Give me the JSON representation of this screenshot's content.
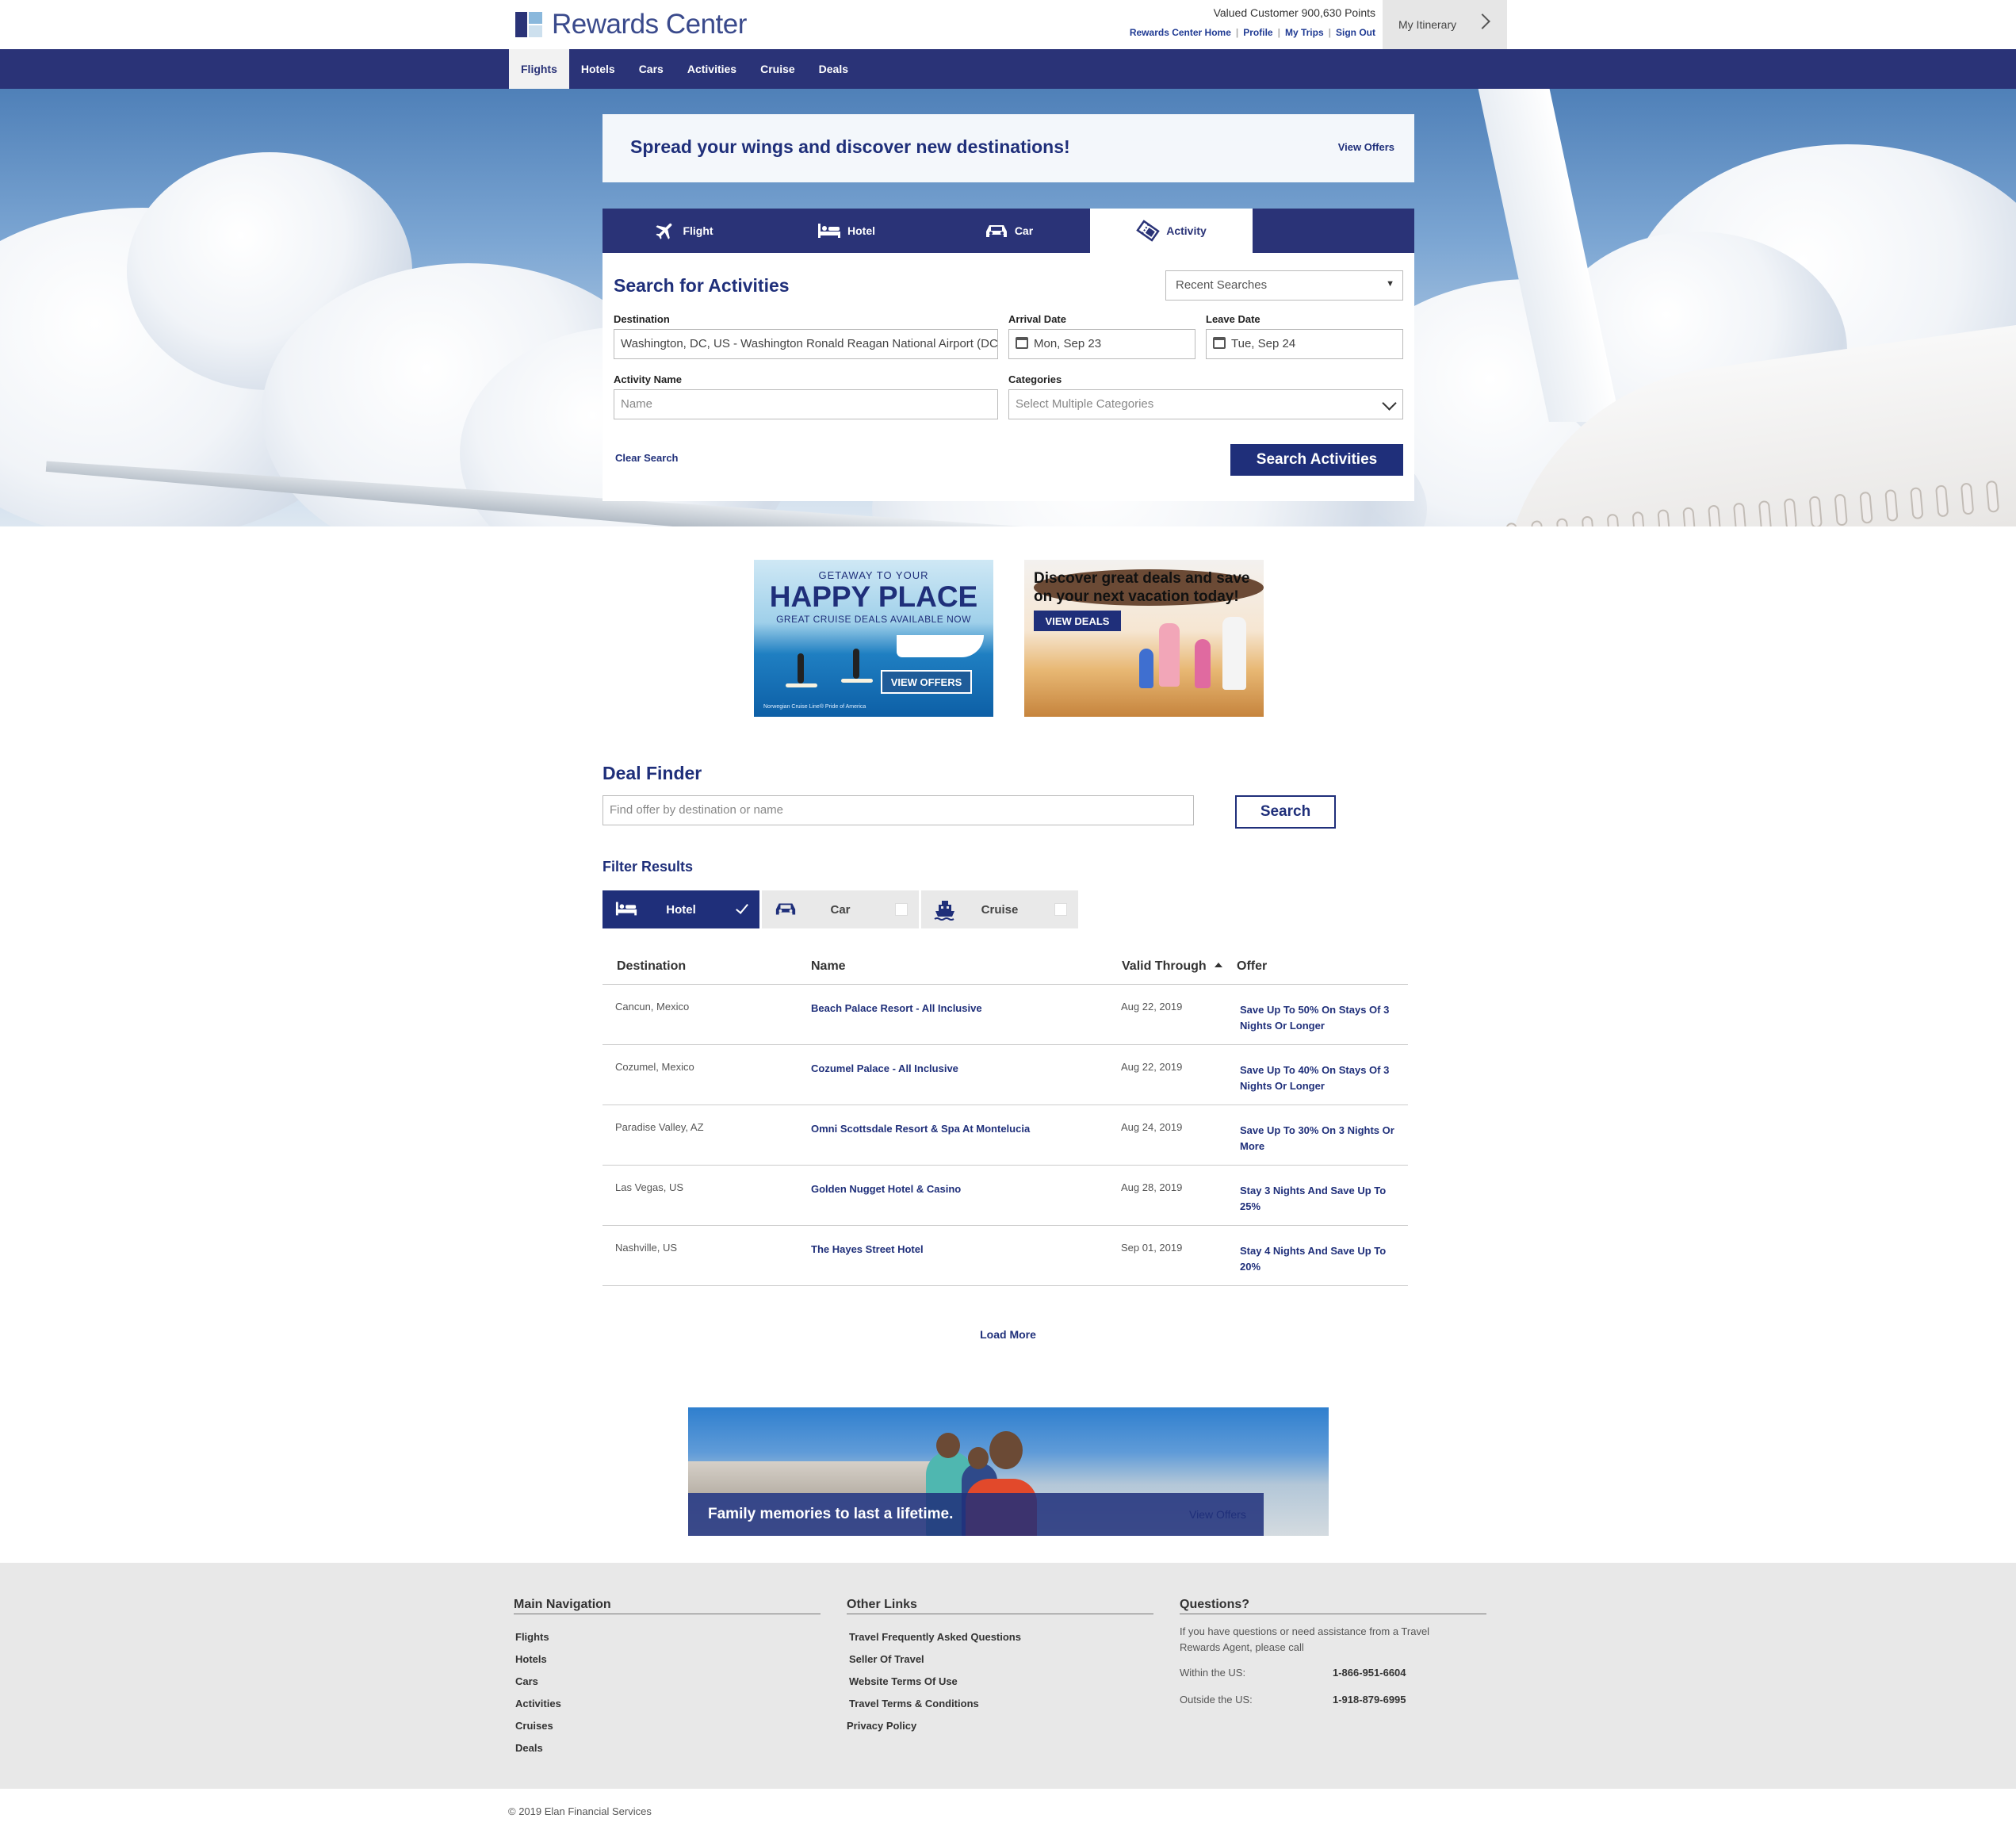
{
  "brand": {
    "name": "Rewards Center",
    "colors": {
      "primary": "#2a3377",
      "link": "#1f2f7a",
      "footer_bg": "#e8e8e8"
    }
  },
  "header": {
    "customer": "Valued Customer 900,630 Points",
    "links": [
      "Rewards Center Home",
      "Profile",
      "My Trips",
      "Sign Out"
    ],
    "itinerary": "My Itinerary"
  },
  "nav": {
    "items": [
      "Flights",
      "Hotels",
      "Cars",
      "Activities",
      "Cruise",
      "Deals"
    ],
    "active": "Flights"
  },
  "promo": {
    "title": "Spread your wings and discover new destinations!",
    "link": "View Offers"
  },
  "search_tabs": [
    {
      "label": "Flight",
      "icon": "airplane-icon"
    },
    {
      "label": "Hotel",
      "icon": "bed-icon"
    },
    {
      "label": "Car",
      "icon": "car-icon"
    },
    {
      "label": "Activity",
      "icon": "ticket-icon",
      "active": true
    }
  ],
  "search": {
    "title": "Search for Activities",
    "recent": "Recent Searches",
    "destination_label": "Destination",
    "destination_value": "Washington, DC, US - Washington Ronald Reagan National  Airport (DCA)",
    "arrival_label": "Arrival Date",
    "arrival_value": "Mon, Sep 23",
    "leave_label": "Leave Date",
    "leave_value": "Tue, Sep 24",
    "activity_label": "Activity Name",
    "activity_placeholder": "Name",
    "categories_label": "Categories",
    "categories_placeholder": "Select Multiple Categories",
    "clear": "Clear Search",
    "button": "Search Activities"
  },
  "ads": {
    "cruise": {
      "small": "GETAWAY TO YOUR",
      "big": "HAPPY PLACE",
      "sub": "GREAT CRUISE DEALS AVAILABLE NOW",
      "button": "VIEW OFFERS",
      "fine": "Norwegian Cruise Line® Pride of America"
    },
    "family": {
      "headline": "Discover great deals and save on your next vacation today!",
      "button": "VIEW DEALS"
    }
  },
  "deal_finder": {
    "title": "Deal Finder",
    "placeholder": "Find offer by destination or name",
    "button": "Search",
    "filter_title": "Filter Results",
    "filters": [
      {
        "label": "Hotel",
        "icon": "bed-icon",
        "checked": true
      },
      {
        "label": "Car",
        "icon": "car-icon",
        "checked": false
      },
      {
        "label": "Cruise",
        "icon": "ship-icon",
        "checked": false
      }
    ],
    "columns": [
      "Destination",
      "Name",
      "Valid Through",
      "Offer"
    ],
    "rows": [
      {
        "destination": "Cancun, Mexico",
        "name": "Beach Palace Resort - All Inclusive",
        "valid": "Aug 22, 2019",
        "offer": "Save Up To 50% On Stays Of 3 Nights Or Longer"
      },
      {
        "destination": "Cozumel, Mexico",
        "name": "Cozumel Palace - All Inclusive",
        "valid": "Aug 22, 2019",
        "offer": "Save Up To 40% On Stays Of 3 Nights Or Longer"
      },
      {
        "destination": "Paradise Valley, AZ",
        "name": "Omni Scottsdale Resort & Spa At Montelucia",
        "valid": "Aug 24, 2019",
        "offer": "Save Up To 30% On 3 Nights Or More"
      },
      {
        "destination": "Las Vegas, US",
        "name": "Golden Nugget Hotel & Casino",
        "valid": "Aug 28, 2019",
        "offer": "Stay 3 Nights And Save Up To 25%"
      },
      {
        "destination": "Nashville, US",
        "name": "The Hayes Street Hotel",
        "valid": "Sep 01, 2019",
        "offer": "Stay 4 Nights And Save Up To 20%"
      }
    ],
    "load_more": "Load More"
  },
  "family_banner": {
    "text": "Family memories to last a lifetime.",
    "link": "View Offers"
  },
  "footer": {
    "main_nav": {
      "title": "Main Navigation",
      "links": [
        "Flights",
        "Hotels",
        "Cars",
        "Activities",
        "Cruises",
        "Deals"
      ]
    },
    "other_links": {
      "title": "Other Links",
      "links": [
        "Travel Frequently Asked Questions",
        "Seller Of Travel",
        "Website Terms Of Use",
        "Travel Terms & Conditions",
        "Privacy Policy"
      ]
    },
    "questions": {
      "title": "Questions?",
      "text": "If you have questions or need assistance from a Travel Rewards Agent, please call",
      "within_label": "Within the US:",
      "within_phone": "1-866-951-6604",
      "outside_label": "Outside the US:",
      "outside_phone": "1-918-879-6995"
    },
    "copyright": "© 2019 Elan Financial Services"
  }
}
